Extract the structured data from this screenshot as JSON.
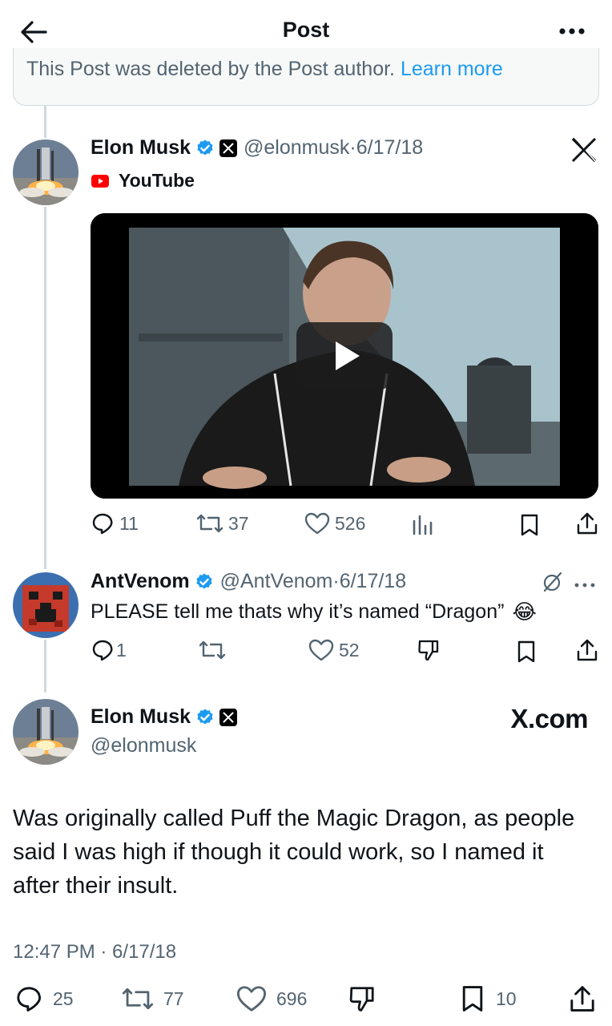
{
  "header": {
    "title": "Post",
    "back_icon": "arrow-left-icon",
    "more_icon": "more-horizontal-icon"
  },
  "deleted_notice": {
    "text": "This Post was deleted by the Post author.",
    "link": "Learn more"
  },
  "quoted_post": {
    "author_name": "Elon Musk",
    "handle": "@elonmusk",
    "separator": "·",
    "date": "6/17/18",
    "source_label": "YouTube",
    "stats": {
      "replies": "11",
      "reposts": "37",
      "likes": "526"
    }
  },
  "reply": {
    "author_name": "AntVenom",
    "handle": "@AntVenom",
    "separator": "·",
    "date": "6/17/18",
    "text": "PLEASE tell me thats why it’s named “Dragon”",
    "emoji": "😂",
    "stats": {
      "replies": "1",
      "likes": "52"
    }
  },
  "main_post": {
    "author_name": "Elon Musk",
    "handle": "@elonmusk",
    "watermark": "X.com",
    "text": "Was originally called Puff the Magic Dragon, as people said I was high if though it could work, so I named it after their insult.",
    "timestamp": "12:47 PM · 6/17/18",
    "stats": {
      "replies": "25",
      "reposts": "77",
      "likes": "696",
      "bookmarks": "10"
    }
  },
  "colors": {
    "accent": "#1d9bf0",
    "text": "#0f1419",
    "muted": "#536471",
    "border": "#cfd9de",
    "youtube": "#ff0000"
  }
}
